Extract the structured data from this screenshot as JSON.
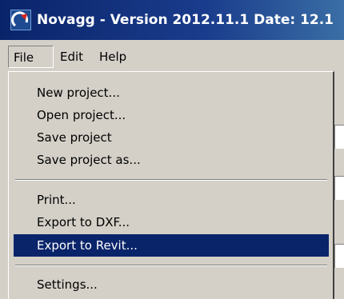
{
  "window": {
    "title": "Novagg - Version  2012.11.1 Date: 12.1",
    "icon": "app-logo-icon"
  },
  "menubar": {
    "items": [
      {
        "label": "File"
      },
      {
        "label": "Edit"
      },
      {
        "label": "Help"
      }
    ]
  },
  "file_menu": {
    "items": [
      {
        "label": "New project..."
      },
      {
        "label": "Open project..."
      },
      {
        "label": "Save project"
      },
      {
        "label": "Save project as..."
      },
      {
        "label": "Print..."
      },
      {
        "label": "Export to DXF..."
      },
      {
        "label": "Export to Revit..."
      },
      {
        "label": "Settings..."
      }
    ],
    "highlighted_item": "Export to Revit..."
  },
  "colors": {
    "titlebar": "#0a246a",
    "menu_highlight": "#0a246a",
    "face": "#d4d0c8"
  }
}
